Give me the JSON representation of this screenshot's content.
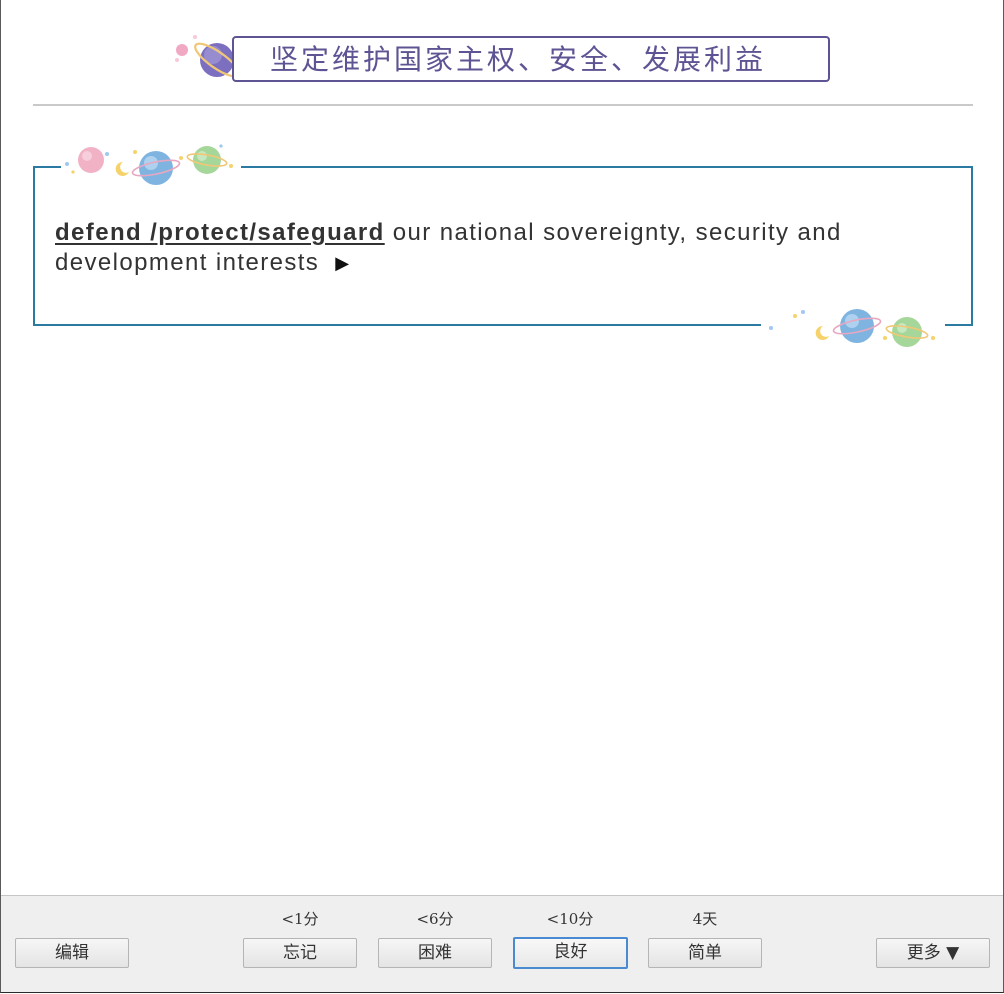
{
  "card": {
    "title": "坚定维护国家主权、安全、发展利益",
    "answer": {
      "keyword": "defend /protect/safeguard",
      "rest": " our national sovereignty, security and development interests",
      "play_icon": "▶"
    }
  },
  "toolbar": {
    "edit_label": "编辑",
    "more_label": "更多 ▼",
    "answers": [
      {
        "interval": "<1分",
        "label": "忘记"
      },
      {
        "interval": "<6分",
        "label": "困难"
      },
      {
        "interval": "<10分",
        "label": "良好"
      },
      {
        "interval": "4天",
        "label": "简单"
      }
    ]
  },
  "colors": {
    "title_accent": "#5e5393",
    "box_border": "#2a7aa2",
    "default_button_border": "#4a8ad0"
  },
  "icons": {
    "title_planet": "planet-icon",
    "top_decoration": "planets-decoration-icon",
    "bottom_decoration": "planets-decoration-icon",
    "play": "play-icon"
  }
}
